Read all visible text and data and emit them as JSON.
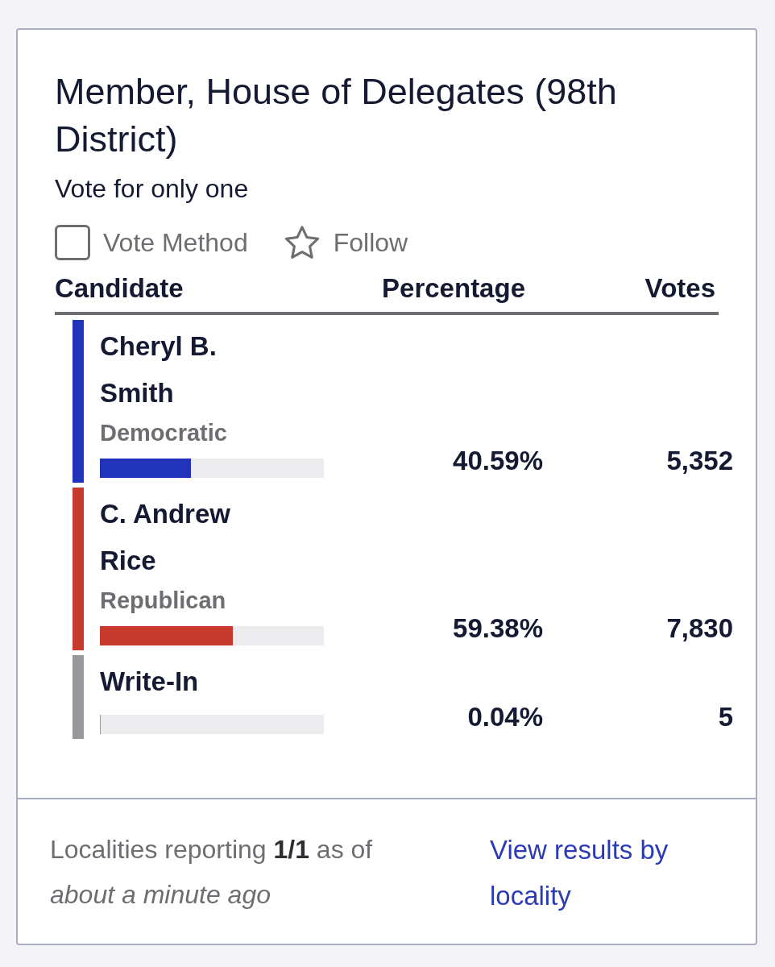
{
  "contest": {
    "title": "Member, House of Delegates (98th District)",
    "instruction": "Vote for only one"
  },
  "options": [
    {
      "kind": "checkbox",
      "label": "Vote Method",
      "checked": false
    },
    {
      "kind": "star",
      "label": "Follow",
      "checked": false
    }
  ],
  "columns": [
    "Candidate",
    "Percentage",
    "Votes"
  ],
  "candidates": [
    {
      "name": "Cheryl B. Smith",
      "party": "Democratic",
      "color": "#2233bb",
      "level": 0.4059,
      "percentage": "40.59%",
      "votes": "5,352"
    },
    {
      "name": "C. Andrew Rice",
      "party": "Republican",
      "color": "#c83a2e",
      "level": 0.5938,
      "percentage": "59.38%",
      "votes": "7,830"
    },
    {
      "name": "Write-In",
      "color": "#98989c",
      "level": 0.0004,
      "percentage": "0.04%",
      "votes": "5"
    }
  ],
  "footer": {
    "status": "Localities reporting **1/1** as of *about a minute ago*",
    "link": "View results by locality"
  }
}
